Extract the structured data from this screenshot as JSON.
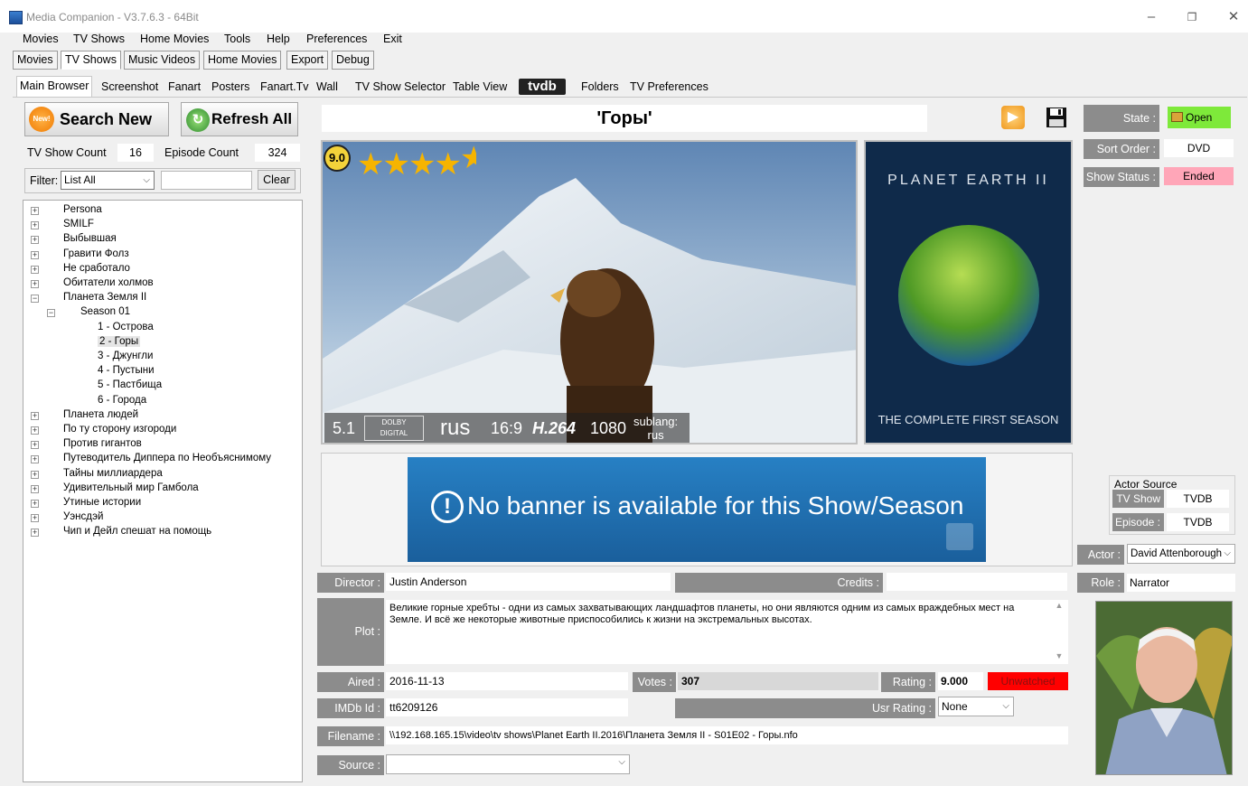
{
  "window": {
    "title": "Media Companion - V3.7.6.3 - 64Bit"
  },
  "menubar": [
    "Movies",
    "TV Shows",
    "Home Movies",
    "Tools",
    "Help",
    "Preferences",
    "Exit"
  ],
  "toolbar": [
    "Movies",
    "TV Shows",
    "Music Videos",
    "Home Movies",
    "Export",
    "Debug"
  ],
  "tabs": [
    "Main Browser",
    "Screenshot",
    "Fanart",
    "Posters",
    "Fanart.Tv",
    "Wall",
    "TV Show Selector",
    "Table View",
    "tvdb",
    "Folders",
    "TV Preferences"
  ],
  "left": {
    "search_new": "Search New",
    "search_new_badge": "New!",
    "refresh_all": "Refresh All",
    "tv_show_count_label": "TV Show Count",
    "tv_show_count": "16",
    "episode_count_label": "Episode Count",
    "episode_count": "324",
    "filter_label": "Filter:",
    "filter_value": "List All",
    "filter_text": "",
    "clear": "Clear",
    "tree": [
      {
        "label": "Persona",
        "level": 0,
        "exp": "+"
      },
      {
        "label": "SMILF",
        "level": 0,
        "exp": "+"
      },
      {
        "label": "Выбывшая",
        "level": 0,
        "exp": "+"
      },
      {
        "label": "Гравити Фолз",
        "level": 0,
        "exp": "+"
      },
      {
        "label": "Не сработало",
        "level": 0,
        "exp": "+"
      },
      {
        "label": "Обитатели холмов",
        "level": 0,
        "exp": "+"
      },
      {
        "label": "Планета Земля II",
        "level": 0,
        "exp": "−"
      },
      {
        "label": "Season 01",
        "level": 1,
        "exp": "−"
      },
      {
        "label": "1 - Острова",
        "level": 2,
        "exp": ""
      },
      {
        "label": "2 - Горы",
        "level": 2,
        "exp": "",
        "selected": true
      },
      {
        "label": "3 - Джунгли",
        "level": 2,
        "exp": ""
      },
      {
        "label": "4 - Пустыни",
        "level": 2,
        "exp": ""
      },
      {
        "label": "5 - Пастбища",
        "level": 2,
        "exp": ""
      },
      {
        "label": "6 - Города",
        "level": 2,
        "exp": ""
      },
      {
        "label": "Планета людей",
        "level": 0,
        "exp": "+"
      },
      {
        "label": "По ту сторону изгороди",
        "level": 0,
        "exp": "+"
      },
      {
        "label": "Против гигантов",
        "level": 0,
        "exp": "+"
      },
      {
        "label": "Путеводитель Диппера по Необъяснимому",
        "level": 0,
        "exp": "+"
      },
      {
        "label": "Тайны миллиардера",
        "level": 0,
        "exp": "+"
      },
      {
        "label": "Удивительный мир Гамбола",
        "level": 0,
        "exp": "+"
      },
      {
        "label": "Утиные истории",
        "level": 0,
        "exp": "+"
      },
      {
        "label": "Уэнсдэй",
        "level": 0,
        "exp": "+"
      },
      {
        "label": "Чип и Дейл спешат на помощь",
        "level": 0,
        "exp": "+"
      }
    ]
  },
  "episode": {
    "title": "'Горы'",
    "rating_badge": "9.0",
    "stars": 4.5,
    "audio_channels": "5.1",
    "dolby_top": "DOLBY",
    "dolby_bottom": "DIGITAL",
    "audio_lang": "rus",
    "aspect": "16:9",
    "codec": "H.264",
    "resolution": "1080",
    "sublang_label": "sublang:",
    "sublang_value": "rus",
    "poster_title": "PLANET EARTH II",
    "poster_sub": "THE COMPLETE FIRST SEASON",
    "banner_text": "No banner is available for this Show/Season",
    "director_label": "Director :",
    "director": "Justin Anderson",
    "credits_label": "Credits :",
    "credits": "",
    "plot_label": "Plot :",
    "plot": "Великие горные хребты - одни из самых захватывающих ландшафтов планеты, но они являются одним из самых враждебных мест на Земле. И всё же некоторые животные приспособились к жизни на экстремальных высотах.",
    "aired_label": "Aired :",
    "aired": "2016-11-13",
    "votes_label": "Votes :",
    "votes": "307",
    "rating_label": "Rating :",
    "rating": "9.000",
    "watched": "Unwatched",
    "imdb_label": "IMDb Id :",
    "imdb": "tt6209126",
    "usr_rating_label": "Usr Rating :",
    "usr_rating": "None",
    "filename_label": "Filename :",
    "filename": "\\\\192.168.165.15\\video\\tv shows\\Planet Earth II.2016\\Планета Земля II - S01E02 - Горы.nfo",
    "source_label": "Source :",
    "source": ""
  },
  "side": {
    "state_label": "State :",
    "state": "Open",
    "sort_order_label": "Sort Order :",
    "sort_order": "DVD",
    "show_status_label": "Show Status :",
    "show_status": "Ended",
    "actor_source_label": "Actor Source",
    "tvshow_label": "TV Show :",
    "tvshow_source": "TVDB",
    "episode_label": "Episode :",
    "episode_source": "TVDB",
    "actor_label": "Actor :",
    "actor": "David Attenborough",
    "role_label": "Role :",
    "role": "Narrator"
  },
  "colors": {
    "open": "#7ee93a",
    "ended": "#ffa6b8",
    "unwatched": "#ff0000",
    "gray_label": "#8c8c8c",
    "banner": "#1f6fb0"
  }
}
